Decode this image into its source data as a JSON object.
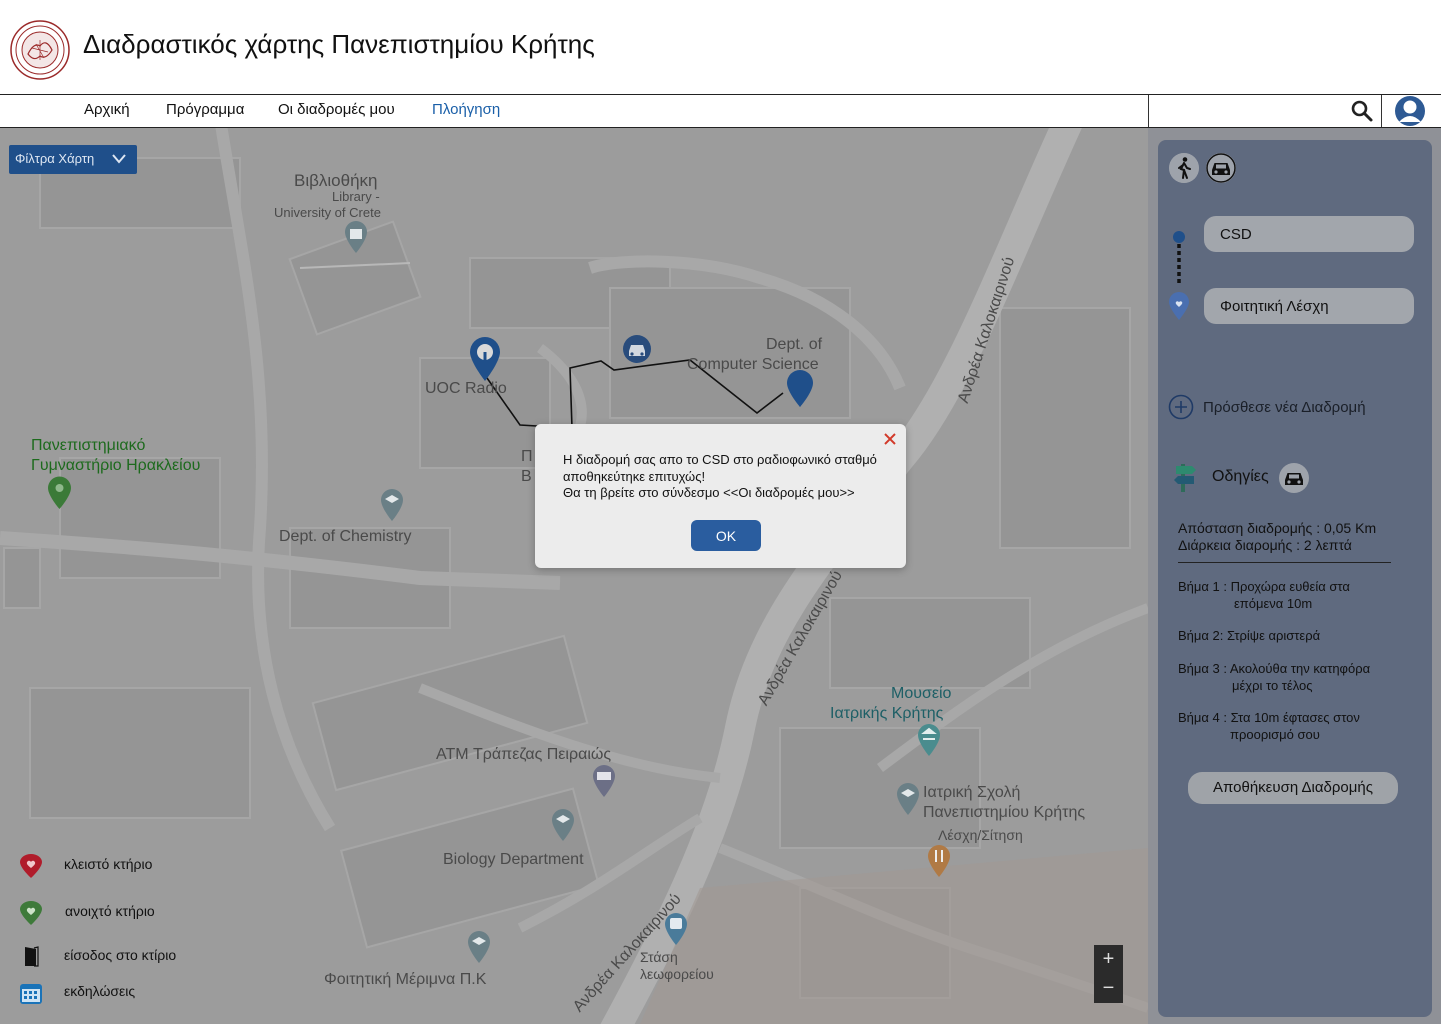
{
  "header": {
    "title": "Διαδραστικός χάρτης Πανεπιστημίου Κρήτης"
  },
  "nav": {
    "items": [
      {
        "label": "Αρχική",
        "active": false
      },
      {
        "label": "Πρόγραμμα",
        "active": false
      },
      {
        "label": "Οι διαδρομές μου",
        "active": false
      },
      {
        "label": "Πλοήγηση",
        "active": true
      }
    ],
    "search_value": "",
    "search_placeholder": ""
  },
  "map": {
    "filters_label": "Φίλτρα Χάρτη",
    "labels": {
      "library_el": "Βιβλιοθήκη",
      "library_en1": "Library -",
      "library_en2": "University of Crete",
      "uoc_radio": "UOC Radio",
      "csd1": "Dept. of",
      "csd2": "Computer Science",
      "gym1": "Πανεπιστημιακό",
      "gym2": "Γυμναστήριο Ηρακλείου",
      "chemistry": "Dept. of Chemistry",
      "partial1": "Π",
      "partial2": "Β",
      "atm": "ATM Τράπεζας Πειραιώς",
      "museum1": "Μουσείο",
      "museum2": "Ιατρικής Κρήτης",
      "medical1": "Ιατρική Σχολή",
      "medical2": "Πανεπιστημίου Κρήτης",
      "club": "Λέσχη/Σίτηση",
      "biology": "Biology Department",
      "bus1": "Στάση",
      "bus2": "λεωφορείου",
      "merimna": "Φοιτητική Μέριμνα Π.Κ",
      "road_top": "Ανδρέα Καλοκαιρινού",
      "road_mid": "Ανδρέα Καλοκαιρινού",
      "road_bottom": "Ανδρέα Καλοκαιρινού"
    },
    "legend": [
      {
        "icon": "red-heart-pin-icon",
        "label": "κλειστό κτήριο",
        "color": "#b01c2b"
      },
      {
        "icon": "green-heart-pin-icon",
        "label": "ανοιχτό κτήριο",
        "color": "#3e7a3a"
      },
      {
        "icon": "door-icon",
        "label": "είσοδος στο κτίριο",
        "color": "#111111"
      },
      {
        "icon": "calendar-icon",
        "label": "εκδηλώσεις",
        "color": "#1a73b8"
      }
    ],
    "zoom_in": "+",
    "zoom_out": "−"
  },
  "panel": {
    "from": "CSD",
    "to": "Φοιτητική Λέσχη",
    "add_route": "Πρόσθεσε νέα Διαδρομή",
    "directions": "Οδηγίες",
    "distance_line": "Απόσταση διαδρομής :  0,05 Km",
    "duration_line": "Διάρκεια διαρομής     :  2 λεπτά",
    "steps": [
      {
        "label": "Βήμα 1 : Προχώρα ευθεία στα",
        "cont": "επόμενα 10m"
      },
      {
        "label": "Βήμα 2: Στρίψε αριστερά",
        "cont": ""
      },
      {
        "label": "Βήμα 3 : Ακολούθα την κατηφόρα",
        "cont": "μέχρι το τέλος"
      },
      {
        "label": "Βήμα 4 : Στα 10m έφτασες στον",
        "cont": "προορισμό σου"
      }
    ],
    "save_button": "Αποθήκευση Διαδρομής"
  },
  "dialog": {
    "line1": "Η διαδρομή σας απο το CSD στο ραδιοφωνικό σταθμό αποθηκεύτηκε επιτυχώς!",
    "line2": "Θα τη βρείτε στο σύνδεσμο <<Οι διαδρομές μου>>",
    "ok": "OK"
  },
  "colors": {
    "accent": "#2a5d9f",
    "nav_active": "#1a5fa8",
    "panel": "#5f6a7f",
    "map_overlay": "#9b9b9b"
  }
}
